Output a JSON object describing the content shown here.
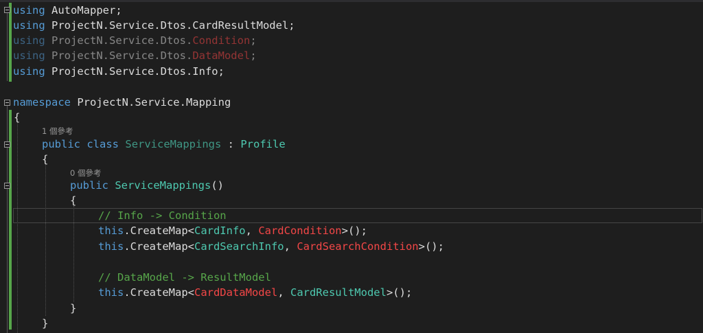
{
  "editor": {
    "using_keyword": "using",
    "namespace_keyword": "namespace",
    "public_keyword": "public",
    "class_keyword": "class",
    "this_keyword": "this",
    "line1_ns": " AutoMapper;",
    "line2_ns": " ProjectN.Service.Dtos.CardResultModel;",
    "line3_prefix": " ProjectN.Service.Dtos.",
    "line3_type": "Condition",
    "line3_end": ";",
    "line4_prefix": " ProjectN.Service.Dtos.",
    "line4_type": "DataModel",
    "line4_end": ";",
    "line5_ns": " ProjectN.Service.Dtos.Info;",
    "namespace_name": " ProjectN.Service.Mapping",
    "open_brace": "{",
    "close_brace": "}",
    "lens_class": "1 個參考",
    "class_name": "ServiceMappings",
    "colon_sep": " : ",
    "base_class": "Profile",
    "lens_ctor": "0 個參考",
    "ctor_name": "ServiceMappings",
    "parens": "()",
    "comment1": "// Info -> Condition",
    "create_map": ".CreateMap<",
    "map1_source": "CardInfo",
    "comma": ", ",
    "map1_dest": "CardCondition",
    "call_end": ">();",
    "map2_source": "CardSearchInfo",
    "map2_dest": "CardSearchCondition",
    "comment2": "// DataModel -> ResultModel",
    "map3_source": "CardDataModel",
    "map3_dest": "CardResultModel"
  },
  "colors": {
    "background": "#1e1e1e",
    "keyword": "#569cd6",
    "type": "#4ec9b0",
    "error_type": "#f44747",
    "comment": "#57a64a",
    "plain": "#dcdcdc",
    "codelens": "#999999",
    "change_bar": "#57a64a"
  }
}
